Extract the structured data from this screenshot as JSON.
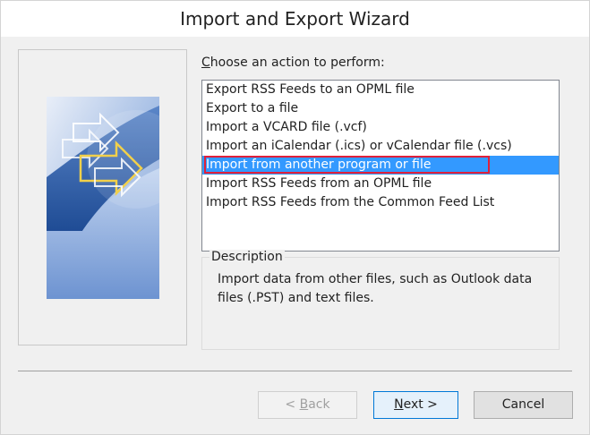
{
  "window": {
    "title": "Import and Export Wizard"
  },
  "action": {
    "label_prefix": "",
    "label_mnemonic": "C",
    "label_rest": "hoose an action to perform:",
    "items": [
      "Export RSS Feeds to an OPML file",
      "Export to a file",
      "Import a VCARD file (.vcf)",
      "Import an iCalendar (.ics) or vCalendar file (.vcs)",
      "Import from another program or file",
      "Import RSS Feeds from an OPML file",
      "Import RSS Feeds from the Common Feed List"
    ],
    "selected_index": 4
  },
  "description": {
    "title": "Description",
    "text": "Import data from other files, such as Outlook data files (.PST) and text files."
  },
  "buttons": {
    "back_prefix": "< ",
    "back_mnemonic": "B",
    "back_rest": "ack",
    "next_mnemonic": "N",
    "next_rest": "ext >",
    "cancel": "Cancel"
  },
  "colors": {
    "selection": "#3399ff",
    "highlight_outline": "#e0203a",
    "art_blue_dark": "#2c5aa0",
    "art_blue_light": "#b8cff0"
  },
  "icons": {
    "wizard_art": "import-export-arrows-graphic"
  }
}
